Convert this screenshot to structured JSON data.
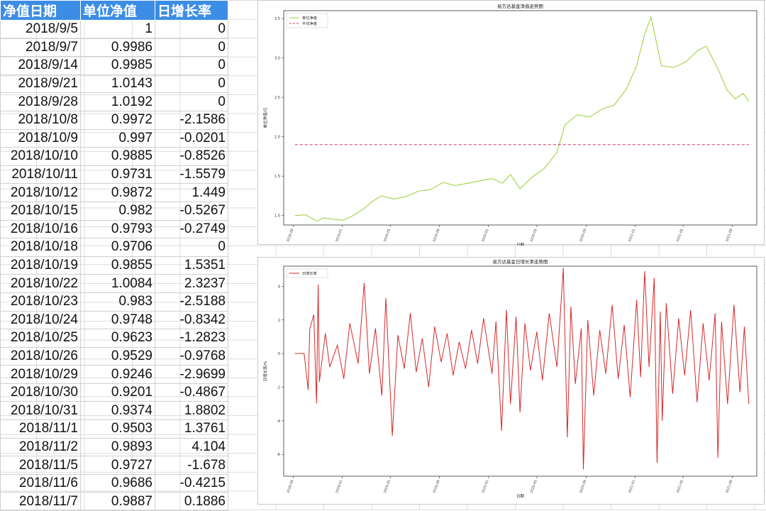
{
  "table": {
    "headers": [
      "净值日期",
      "单位净值",
      "日增长率"
    ],
    "rows": [
      [
        "2018/9/5",
        "1",
        "0"
      ],
      [
        "2018/9/7",
        "0.9986",
        "0"
      ],
      [
        "2018/9/14",
        "0.9985",
        "0"
      ],
      [
        "2018/9/21",
        "1.0143",
        "0"
      ],
      [
        "2018/9/28",
        "1.0192",
        "0"
      ],
      [
        "2018/10/8",
        "0.9972",
        "-2.1586"
      ],
      [
        "2018/10/9",
        "0.997",
        "-0.0201"
      ],
      [
        "2018/10/10",
        "0.9885",
        "-0.8526"
      ],
      [
        "2018/10/11",
        "0.9731",
        "-1.5579"
      ],
      [
        "2018/10/12",
        "0.9872",
        "1.449"
      ],
      [
        "2018/10/15",
        "0.982",
        "-0.5267"
      ],
      [
        "2018/10/16",
        "0.9793",
        "-0.2749"
      ],
      [
        "2018/10/18",
        "0.9706",
        "0"
      ],
      [
        "2018/10/19",
        "0.9855",
        "1.5351"
      ],
      [
        "2018/10/22",
        "1.0084",
        "2.3237"
      ],
      [
        "2018/10/23",
        "0.983",
        "-2.5188"
      ],
      [
        "2018/10/24",
        "0.9748",
        "-0.8342"
      ],
      [
        "2018/10/25",
        "0.9623",
        "-1.2823"
      ],
      [
        "2018/10/26",
        "0.9529",
        "-0.9768"
      ],
      [
        "2018/10/29",
        "0.9246",
        "-2.9699"
      ],
      [
        "2018/10/30",
        "0.9201",
        "-0.4867"
      ],
      [
        "2018/10/31",
        "0.9374",
        "1.8802"
      ],
      [
        "2018/11/1",
        "0.9503",
        "1.3761"
      ],
      [
        "2018/11/2",
        "0.9893",
        "4.104"
      ],
      [
        "2018/11/5",
        "0.9727",
        "-1.678"
      ],
      [
        "2018/11/6",
        "0.9686",
        "-0.4215"
      ],
      [
        "2018/11/7",
        "0.9887",
        "0.1886"
      ]
    ]
  },
  "chart_data": [
    {
      "type": "line",
      "title": "易方达基金净值走势图",
      "xlabel": "日期",
      "ylabel": "单位净值/元",
      "yticks": [
        "1.0",
        "1.5",
        "2.0",
        "2.5",
        "3.0",
        "3.5"
      ],
      "ylim": [
        0.88,
        3.6
      ],
      "xticks": [
        "2018-09",
        "2019-01",
        "2019-05",
        "2019-09",
        "2020-01",
        "2020-05",
        "2020-09",
        "2021-01",
        "2021-05",
        "2021-09"
      ],
      "xlim": [
        "2018-08-08",
        "2021-11-01"
      ],
      "legend_position": "top-left",
      "series": [
        {
          "name": "单位净值",
          "color": "#9acd32",
          "style": "solid",
          "points": [
            [
              "2018-09-05",
              1.0
            ],
            [
              "2018-10-01",
              1.01
            ],
            [
              "2018-10-30",
              0.93
            ],
            [
              "2018-11-15",
              0.97
            ],
            [
              "2018-12-15",
              0.95
            ],
            [
              "2019-01-04",
              0.94
            ],
            [
              "2019-01-25",
              0.99
            ],
            [
              "2019-02-25",
              1.09
            ],
            [
              "2019-03-15",
              1.17
            ],
            [
              "2019-04-08",
              1.25
            ],
            [
              "2019-05-10",
              1.21
            ],
            [
              "2019-06-10",
              1.24
            ],
            [
              "2019-07-10",
              1.31
            ],
            [
              "2019-08-10",
              1.33
            ],
            [
              "2019-09-10",
              1.42
            ],
            [
              "2019-10-10",
              1.38
            ],
            [
              "2019-11-10",
              1.41
            ],
            [
              "2019-12-10",
              1.44
            ],
            [
              "2020-01-10",
              1.47
            ],
            [
              "2020-02-05",
              1.41
            ],
            [
              "2020-02-25",
              1.52
            ],
            [
              "2020-03-20",
              1.34
            ],
            [
              "2020-04-20",
              1.49
            ],
            [
              "2020-05-20",
              1.6
            ],
            [
              "2020-06-20",
              1.8
            ],
            [
              "2020-07-10",
              2.15
            ],
            [
              "2020-08-10",
              2.28
            ],
            [
              "2020-09-10",
              2.25
            ],
            [
              "2020-10-10",
              2.35
            ],
            [
              "2020-11-10",
              2.4
            ],
            [
              "2020-12-10",
              2.6
            ],
            [
              "2021-01-05",
              2.9
            ],
            [
              "2021-01-25",
              3.3
            ],
            [
              "2021-02-10",
              3.52
            ],
            [
              "2021-03-08",
              2.9
            ],
            [
              "2021-04-08",
              2.88
            ],
            [
              "2021-05-08",
              2.95
            ],
            [
              "2021-06-08",
              3.1
            ],
            [
              "2021-06-28",
              3.15
            ],
            [
              "2021-07-28",
              2.85
            ],
            [
              "2021-08-18",
              2.6
            ],
            [
              "2021-09-08",
              2.48
            ],
            [
              "2021-09-28",
              2.55
            ],
            [
              "2021-10-12",
              2.45
            ]
          ]
        },
        {
          "name": "平均净值",
          "color": "#e0306a",
          "style": "dashed",
          "points": [
            [
              "2018-09-05",
              1.9
            ],
            [
              "2021-10-12",
              1.9
            ]
          ]
        }
      ]
    },
    {
      "type": "line",
      "title": "易方达基金日增长率走势图",
      "xlabel": "日期",
      "ylabel": "日增长率/%",
      "yticks": [
        "-6",
        "-4",
        "-2",
        "0",
        "2",
        "4"
      ],
      "ylim": [
        -7.3,
        5.2
      ],
      "xticks": [
        "2018-09",
        "2019-01",
        "2019-05",
        "2019-09",
        "2020-01",
        "2020-05",
        "2020-09",
        "2021-01",
        "2021-05",
        "2021-09"
      ],
      "xlim": [
        "2018-08-08",
        "2021-11-01"
      ],
      "legend_position": "top-left",
      "series": [
        {
          "name": "日增长率",
          "color": "#d62728",
          "style": "solid",
          "points": [
            [
              "2018-09-05",
              0
            ],
            [
              "2018-09-28",
              0
            ],
            [
              "2018-10-08",
              -2.16
            ],
            [
              "2018-10-12",
              1.45
            ],
            [
              "2018-10-22",
              2.32
            ],
            [
              "2018-10-29",
              -2.97
            ],
            [
              "2018-11-02",
              4.1
            ],
            [
              "2018-11-05",
              -1.68
            ],
            [
              "2018-11-20",
              1.2
            ],
            [
              "2018-12-01",
              -0.8
            ],
            [
              "2018-12-20",
              0.5
            ],
            [
              "2019-01-05",
              -1.5
            ],
            [
              "2019-01-20",
              1.8
            ],
            [
              "2019-02-10",
              -0.6
            ],
            [
              "2019-02-25",
              4.2
            ],
            [
              "2019-03-10",
              -1.2
            ],
            [
              "2019-03-25",
              1.5
            ],
            [
              "2019-04-10",
              -2.5
            ],
            [
              "2019-04-20",
              3.3
            ],
            [
              "2019-05-06",
              -4.9
            ],
            [
              "2019-05-20",
              1.1
            ],
            [
              "2019-06-05",
              -0.9
            ],
            [
              "2019-06-20",
              2.4
            ],
            [
              "2019-07-05",
              -1.1
            ],
            [
              "2019-07-20",
              0.9
            ],
            [
              "2019-08-05",
              -2.0
            ],
            [
              "2019-08-20",
              1.6
            ],
            [
              "2019-09-05",
              -0.5
            ],
            [
              "2019-09-20",
              1.2
            ],
            [
              "2019-10-05",
              -1.3
            ],
            [
              "2019-10-20",
              0.7
            ],
            [
              "2019-11-05",
              -0.9
            ],
            [
              "2019-11-20",
              1.4
            ],
            [
              "2019-12-05",
              -0.6
            ],
            [
              "2019-12-20",
              2.1
            ],
            [
              "2020-01-10",
              -1.2
            ],
            [
              "2020-01-20",
              1.9
            ],
            [
              "2020-02-03",
              -4.6
            ],
            [
              "2020-02-15",
              2.6
            ],
            [
              "2020-02-25",
              -3.0
            ],
            [
              "2020-03-10",
              2.2
            ],
            [
              "2020-03-20",
              -3.5
            ],
            [
              "2020-04-01",
              1.8
            ],
            [
              "2020-04-15",
              -1.0
            ],
            [
              "2020-05-01",
              1.3
            ],
            [
              "2020-05-15",
              -1.6
            ],
            [
              "2020-06-01",
              2.4
            ],
            [
              "2020-06-20",
              -0.8
            ],
            [
              "2020-07-06",
              5.1
            ],
            [
              "2020-07-16",
              -5.0
            ],
            [
              "2020-07-25",
              2.8
            ],
            [
              "2020-08-05",
              -1.8
            ],
            [
              "2020-08-20",
              1.5
            ],
            [
              "2020-08-25",
              -6.9
            ],
            [
              "2020-09-05",
              2.0
            ],
            [
              "2020-09-20",
              -2.5
            ],
            [
              "2020-10-05",
              1.4
            ],
            [
              "2020-10-20",
              -1.2
            ],
            [
              "2020-11-05",
              2.9
            ],
            [
              "2020-11-20",
              -1.5
            ],
            [
              "2020-12-05",
              1.7
            ],
            [
              "2020-12-20",
              -2.6
            ],
            [
              "2021-01-05",
              3.2
            ],
            [
              "2021-01-15",
              -1.4
            ],
            [
              "2021-01-25",
              4.9
            ],
            [
              "2021-02-05",
              -0.8
            ],
            [
              "2021-02-18",
              4.5
            ],
            [
              "2021-02-25",
              -6.5
            ],
            [
              "2021-03-05",
              2.5
            ],
            [
              "2021-03-10",
              -4.0
            ],
            [
              "2021-03-20",
              3.0
            ],
            [
              "2021-04-05",
              -2.4
            ],
            [
              "2021-04-20",
              2.1
            ],
            [
              "2021-05-05",
              -1.3
            ],
            [
              "2021-05-20",
              2.6
            ],
            [
              "2021-06-05",
              -2.9
            ],
            [
              "2021-06-20",
              1.8
            ],
            [
              "2021-07-05",
              -1.6
            ],
            [
              "2021-07-20",
              2.4
            ],
            [
              "2021-07-27",
              -6.2
            ],
            [
              "2021-08-05",
              1.9
            ],
            [
              "2021-08-20",
              -3.0
            ],
            [
              "2021-09-05",
              2.9
            ],
            [
              "2021-09-20",
              -2.3
            ],
            [
              "2021-10-01",
              1.6
            ],
            [
              "2021-10-12",
              -3.0
            ]
          ]
        }
      ]
    }
  ]
}
